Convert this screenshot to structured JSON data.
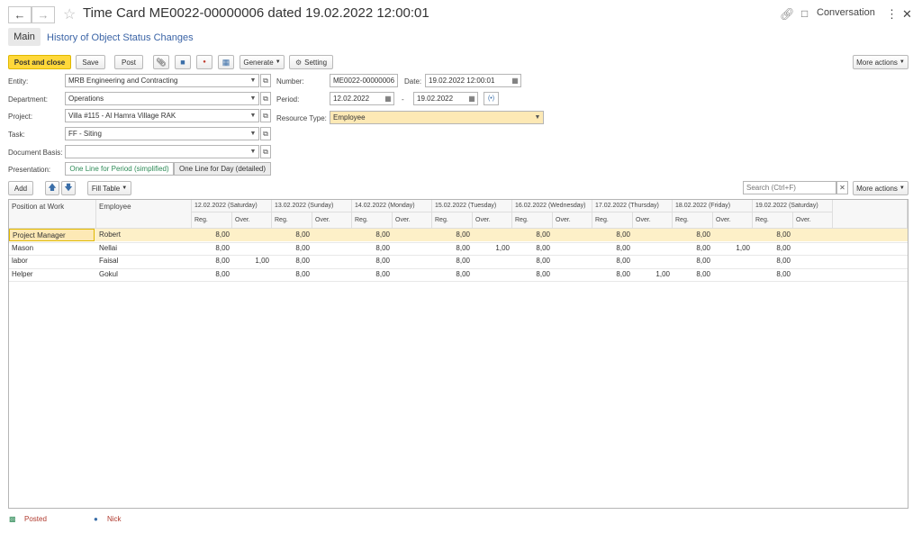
{
  "window": {
    "title": "Time Card ME0022-00000006 dated 19.02.2022 12:00:01",
    "conversation_label": "Conversation"
  },
  "tabs": {
    "main": "Main",
    "history": "History of Object Status Changes"
  },
  "toolbar": {
    "post_close": "Post and close",
    "save": "Save",
    "post": "Post",
    "generate": "Generate",
    "setting": "Setting",
    "more_actions": "More actions"
  },
  "form": {
    "entity_label": "Entity:",
    "entity_value": "MRB Engineering and Contracting",
    "department_label": "Department:",
    "department_value": "Operations",
    "project_label": "Project:",
    "project_value": "Villa #115 - Al Hamra Village RAK",
    "task_label": "Task:",
    "task_value": "FF - Siting",
    "basis_label": "Document Basis:",
    "basis_value": "",
    "presentation_label": "Presentation:",
    "presentation_opt1": "One Line for Period (simplified)",
    "presentation_opt2": "One Line for Day (detailed)",
    "number_label": "Number:",
    "number_value": "ME0022-00000006",
    "date_label": "Date:",
    "date_value": "19.02.2022 12:00:01",
    "period_label": "Period:",
    "period_from": "12.02.2022",
    "period_sep": "-",
    "period_to": "19.02.2022",
    "resource_label": "Resource Type:",
    "resource_value": "Employee"
  },
  "table_toolbar": {
    "add": "Add",
    "fill_table": "Fill Table",
    "search_placeholder": "Search (Ctrl+F)",
    "more_actions": "More actions"
  },
  "table": {
    "col_position": "Position at Work",
    "col_employee": "Employee",
    "days": [
      "12.02.2022 (Saturday)",
      "13.02.2022 (Sunday)",
      "14.02.2022 (Monday)",
      "15.02.2022 (Tuesday)",
      "16.02.2022 (Wednesday)",
      "17.02.2022 (Thursday)",
      "18.02.2022 (Friday)",
      "19.02.2022 (Saturday)"
    ],
    "sub_reg": "Reg.",
    "sub_over": "Over.",
    "rows": [
      {
        "position": "Project Manager",
        "employee": "Robert",
        "vals": [
          "8,00",
          "",
          "8,00",
          "",
          "8,00",
          "",
          "8,00",
          "",
          "8,00",
          "",
          "8,00",
          "",
          "8,00",
          "",
          "8,00",
          ""
        ]
      },
      {
        "position": "Mason",
        "employee": "Nellai",
        "vals": [
          "8,00",
          "",
          "8,00",
          "",
          "8,00",
          "",
          "8,00",
          "1,00",
          "8,00",
          "",
          "8,00",
          "",
          "8,00",
          "1,00",
          "8,00",
          ""
        ]
      },
      {
        "position": "labor",
        "employee": "Faisal",
        "vals": [
          "8,00",
          "1,00",
          "8,00",
          "",
          "8,00",
          "",
          "8,00",
          "",
          "8,00",
          "",
          "8,00",
          "",
          "8,00",
          "",
          "8,00",
          ""
        ]
      },
      {
        "position": "Helper",
        "employee": "Gokul",
        "vals": [
          "8,00",
          "",
          "8,00",
          "",
          "8,00",
          "",
          "8,00",
          "",
          "8,00",
          "",
          "8,00",
          "1,00",
          "8,00",
          "",
          "8,00",
          ""
        ]
      }
    ]
  },
  "status_bar": {
    "posted": "Posted",
    "user": "Nick"
  }
}
